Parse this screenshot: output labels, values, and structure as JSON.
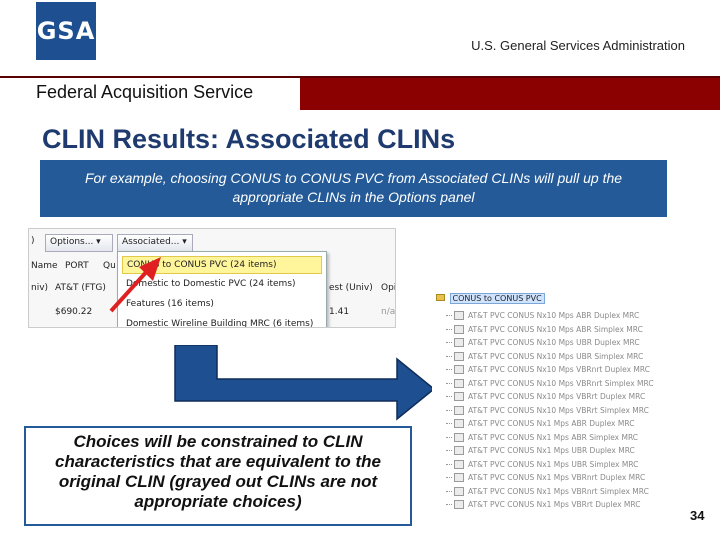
{
  "header": {
    "logo_text": "GSA",
    "agency": "U.S. General Services Administration",
    "service": "Federal Acquisition Service",
    "band_color": "#8b0000",
    "logo_color": "#1d4f91"
  },
  "slide": {
    "title": "CLIN Results:  Associated CLINs",
    "callout_top": "For example, choosing CONUS to CONUS PVC from Associated CLINs will pull up the appropriate CLINs in the Options panel",
    "callout_bottom": "Choices will be constrained to CLIN characteristics that are equivalent to the original CLIN (grayed out CLINs are not appropriate choices)",
    "page_number": "34",
    "accent_color": "#235a97"
  },
  "left_screenshot": {
    "toolbar": {
      "paren": ")",
      "options_label": "Options... ▾",
      "associated_label": "Associated... ▾"
    },
    "headers": {
      "name": "Name",
      "port": "PORT",
      "qu": "Qu",
      "est": "est (Univ)",
      "op": "Opi",
      "niv": "niv)",
      "att": "AT&T (FTG)"
    },
    "values": {
      "price": "$690.22",
      "mid": "1.41",
      "na": "n/a"
    },
    "menu_items": [
      "CONUS to CONUS PVC (24 items)",
      "Domestic to Domestic PVC (24 items)",
      "Features (16 items)",
      "Domestic Wireline Building MRC (6 items)"
    ]
  },
  "right_panel": {
    "root_label": "CONUS to CONUS PVC",
    "items": [
      "AT&T PVC CONUS Nx10 Mps ABR Duplex MRC",
      "AT&T PVC CONUS Nx10 Mps ABR Simplex MRC",
      "AT&T PVC CONUS Nx10 Mps UBR Duplex MRC",
      "AT&T PVC CONUS Nx10 Mps UBR Simplex MRC",
      "AT&T PVC CONUS Nx10 Mps VBRnrt Duplex MRC",
      "AT&T PVC CONUS Nx10 Mps VBRnrt Simplex MRC",
      "AT&T PVC CONUS Nx10 Mps VBRrt Duplex MRC",
      "AT&T PVC CONUS Nx10 Mps VBRrt Simplex MRC",
      "AT&T PVC CONUS Nx1 Mps ABR Duplex MRC",
      "AT&T PVC CONUS Nx1 Mps ABR Simplex MRC",
      "AT&T PVC CONUS Nx1 Mps UBR Duplex MRC",
      "AT&T PVC CONUS Nx1 Mps UBR Simplex MRC",
      "AT&T PVC CONUS Nx1 Mps VBRnrt Duplex MRC",
      "AT&T PVC CONUS Nx1 Mps VBRnrt Simplex MRC",
      "AT&T PVC CONUS Nx1 Mps VBRrt Duplex MRC"
    ]
  }
}
